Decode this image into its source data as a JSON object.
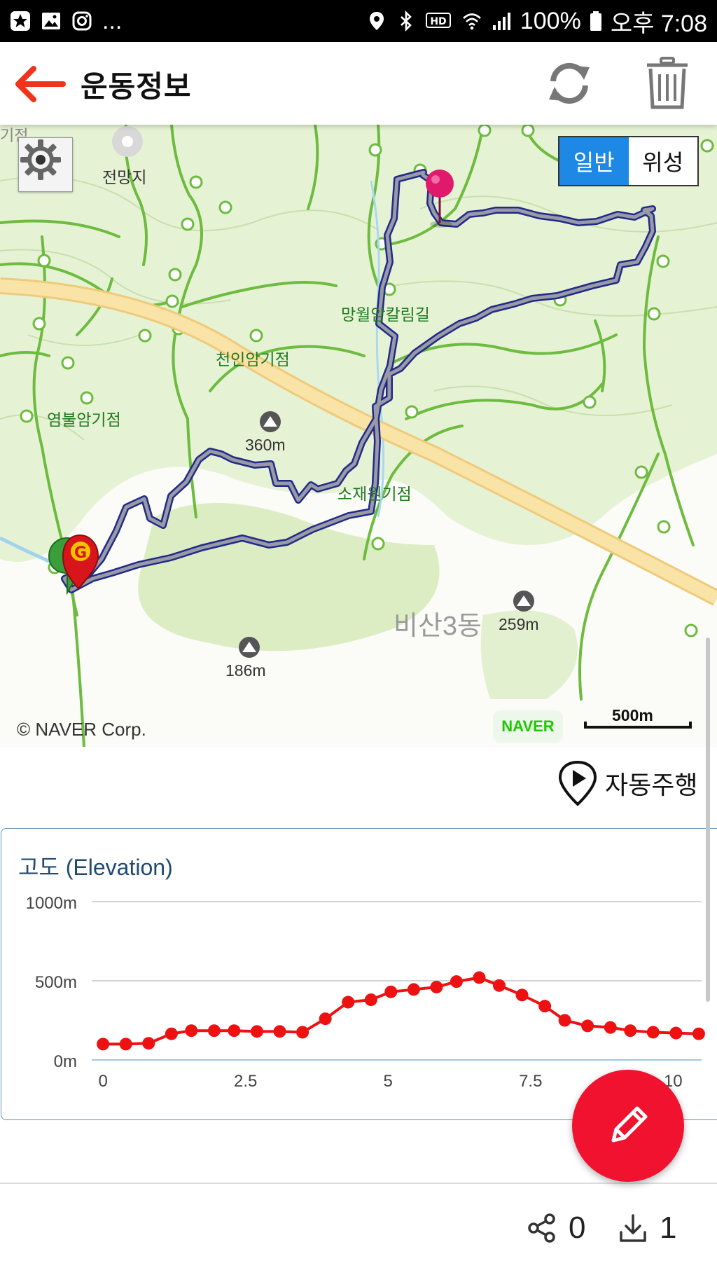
{
  "status_bar": {
    "left_more": "...",
    "battery": "100%",
    "time": "오후 7:08",
    "hd_label": "HD"
  },
  "app_bar": {
    "title": "운동정보",
    "back_icon": "arrow-left-icon",
    "refresh_icon": "refresh-icon",
    "delete_icon": "trash-icon"
  },
  "map": {
    "toggle": {
      "normal": "일반",
      "satellite": "위성"
    },
    "labels": {
      "viewpoint": "전망지",
      "giji_top": "기점",
      "mangwol": "망월암칼림길",
      "cheonin": "천인암기점",
      "yeombul": "염불암기점",
      "peak360": "360m",
      "sojae": "소재원기점",
      "bisan": "비산3동",
      "peak259": "259m",
      "peak186": "186m"
    },
    "markers": {
      "goal": "G"
    },
    "copyright": "© NAVER Corp.",
    "logo": "NAVER",
    "scale": "500m"
  },
  "auto_drive": {
    "label": "자동주행"
  },
  "elevation": {
    "title": "고도 (Elevation)"
  },
  "chart_data": {
    "type": "line",
    "title": "고도 (Elevation)",
    "xlabel": "",
    "ylabel": "",
    "xlim": [
      -0.1,
      10.5
    ],
    "ylim": [
      0,
      1000
    ],
    "x_ticks": [
      "0",
      "2.5",
      "5",
      "7.5",
      "10"
    ],
    "y_ticks": [
      "1000m",
      "500m",
      "0m"
    ],
    "grid": true,
    "series": [
      {
        "color": "#ee1111",
        "x": [
          0,
          0.4,
          0.8,
          1.2,
          1.55,
          1.95,
          2.3,
          2.7,
          3.1,
          3.5,
          3.9,
          4.3,
          4.7,
          5.05,
          5.45,
          5.85,
          6.2,
          6.6,
          6.95,
          7.35,
          7.75,
          8.1,
          8.5,
          8.9,
          9.25,
          9.65,
          10.05,
          10.45
        ],
        "y": [
          100,
          100,
          105,
          165,
          185,
          185,
          185,
          180,
          180,
          175,
          260,
          365,
          380,
          430,
          445,
          460,
          495,
          520,
          470,
          410,
          340,
          250,
          215,
          205,
          185,
          175,
          170,
          165
        ]
      }
    ]
  },
  "bottom": {
    "share_count": "0",
    "download_count": "1"
  }
}
